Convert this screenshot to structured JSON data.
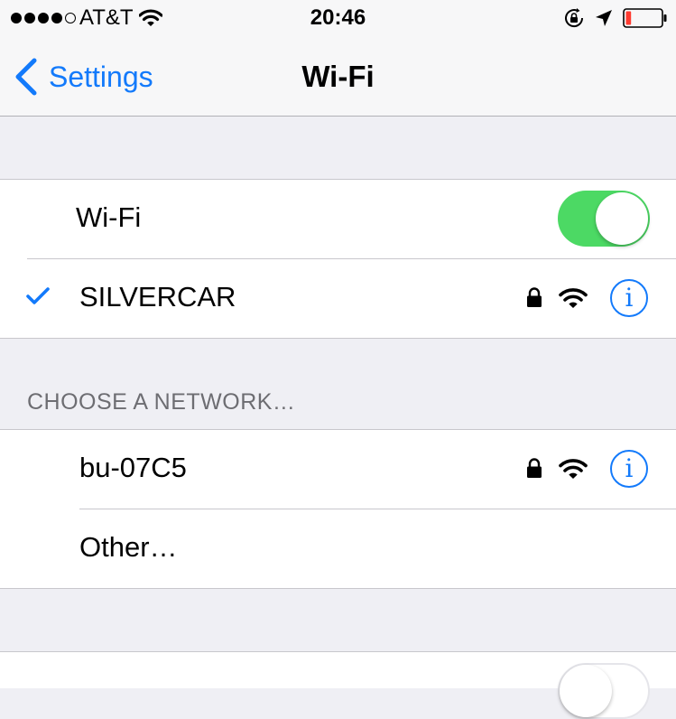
{
  "status_bar": {
    "carrier": "AT&T",
    "time": "20:46",
    "signal_bars_filled": 4,
    "signal_bars_total": 5,
    "wifi_icon": "wifi-icon",
    "rotation_lock_icon": "rotation-lock-icon",
    "location_icon": "location-arrow-icon",
    "battery_icon": "battery-icon",
    "battery_level": 0.15,
    "battery_color": "#ff3b30"
  },
  "nav": {
    "back_label": "Settings",
    "back_icon": "chevron-left-icon",
    "title": "Wi-Fi"
  },
  "wifi_toggle": {
    "label": "Wi-Fi",
    "on": true,
    "on_color": "#4cd964"
  },
  "connected_network": {
    "name": "SILVERCAR",
    "checked": true,
    "secured": true,
    "info_label": "i"
  },
  "choose_section": {
    "header": "CHOOSE A NETWORK…",
    "networks": [
      {
        "name": "bu-07C5",
        "secured": true,
        "info_label": "i"
      }
    ],
    "other_label": "Other…"
  },
  "colors": {
    "accent": "#137afb",
    "background": "#efeff4",
    "separator": "#c8c7cc",
    "section_header": "#6d6d72"
  }
}
